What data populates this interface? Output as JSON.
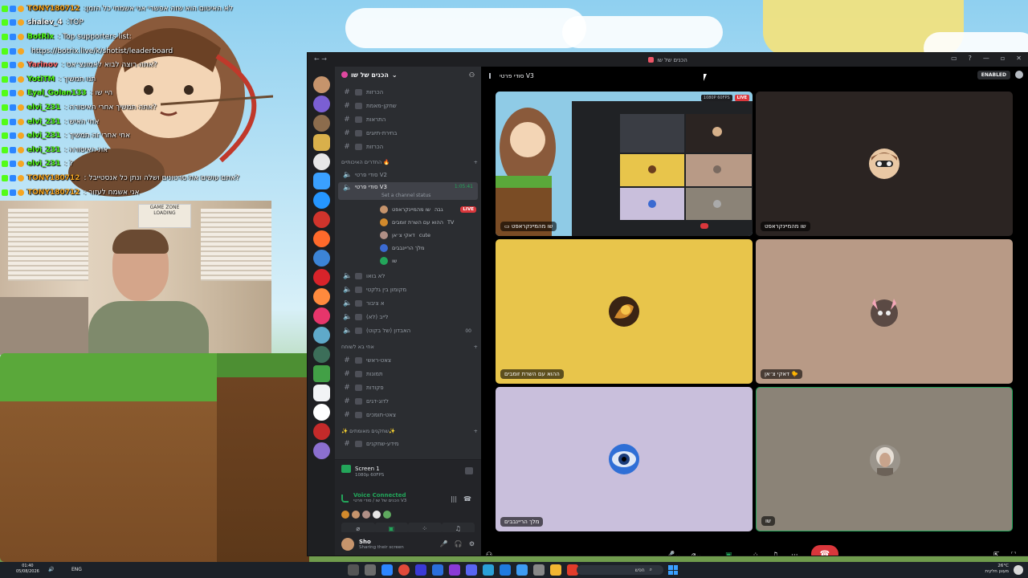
{
  "chat": [
    {
      "name": "TONY180712",
      "color": "#f5a623",
      "msg": ":לא האיטום הוא שזה אפשרי אני אשמחי כל הזמן"
    },
    {
      "name": "shalev_4",
      "color": "#ffffff",
      "msg": ":TOP"
    },
    {
      "name": "BotRix",
      "color": "#53fc18",
      "msg": ": Top supporters list:"
    },
    {
      "name": "",
      "color": "#8a7cff",
      "msg": "https://botrix.live/k/shotist/leaderboard"
    },
    {
      "name": "Yarinov",
      "color": "#ff6b6b",
      "msg": ": אתה רוצה לבוא לאמונצ׳אס?"
    },
    {
      "name": "YotiTM",
      "color": "#53fc18",
      "msg": ": תנו תמשיך"
    },
    {
      "name": "Eyal_Golan133",
      "color": "#53fc18",
      "msg": ": היי שו"
    },
    {
      "name": "elvi_231",
      "color": "#53fc18",
      "msg": ": אתה תמשיך אחרי האיסורה?"
    },
    {
      "name": "elvi_231",
      "color": "#53fc18",
      "msg": ": אחי האיש"
    },
    {
      "name": "elvi_231",
      "color": "#53fc18",
      "msg": ": אחי אחרי זה תמשיך"
    },
    {
      "name": "elvi_231",
      "color": "#53fc18",
      "msg": ": את האיסורה"
    },
    {
      "name": "elvi_231",
      "color": "#53fc18",
      "msg": ": ?"
    },
    {
      "name": "TONY180712",
      "color": "#f5a623",
      "msg": ": אתם עושים את סרטונים ושלה ונתן כל אנסטייבל?"
    },
    {
      "name": "TONY180712",
      "color": "#f5a623",
      "msg": ": אני אשמח לעזור"
    }
  ],
  "webcam": {
    "poster_line1": "GAME ZONE",
    "poster_line2": "LOADING"
  },
  "window": {
    "title": "הכנים של שו"
  },
  "server": {
    "name": "הכנים של שו"
  },
  "channels": [
    {
      "type": "text",
      "label": "הכרזות",
      "y": 0
    },
    {
      "type": "text",
      "label": "שחקן-מאמת",
      "y": 17
    },
    {
      "type": "text",
      "label": "התראות",
      "y": 34
    },
    {
      "type": "text",
      "label": "בחירת-תיוגים",
      "y": 51
    },
    {
      "type": "text",
      "label": "הכרזות",
      "y": 68
    }
  ],
  "category1": {
    "label": "החדרים האיכותיים 🔥"
  },
  "voice_channels_top": [
    {
      "label": "סודי פרטי V2",
      "active": false
    },
    {
      "label": "סודי פרטי V3",
      "active": true,
      "timer": "1:05:41",
      "status": "Set a channel status"
    }
  ],
  "voice_users": [
    {
      "name": "שו מהמיינקראפט",
      "tag": "גבה",
      "live": "LIVE",
      "color": "#c6946c"
    },
    {
      "name": "ההוא עם השרת זומבים",
      "tag": "TV",
      "live": "",
      "color": "#d28a2c"
    },
    {
      "name": "דאקי צ׳אן",
      "tag": "cute",
      "live": "",
      "color": "#b08f86"
    },
    {
      "name": "מלך הריינבבים",
      "tag": "",
      "live": "",
      "color": "#3b6ad1"
    },
    {
      "name": "שו",
      "tag": "",
      "live": "",
      "color": "#23a55a"
    }
  ],
  "voice_channels_mid": [
    {
      "label": "לא בואו"
    },
    {
      "label": "מקומון בין גלקטי"
    },
    {
      "label": "א ציבור"
    },
    {
      "label": "לייב (לא)"
    },
    {
      "label": "האבדון (של בקוט)",
      "count": "00"
    }
  ],
  "category2": {
    "label": "אחי בא לשוחח"
  },
  "text_channels_bottom": [
    {
      "label": "צאט-ראשי"
    },
    {
      "label": "תמונות"
    },
    {
      "label": "פקודות"
    },
    {
      "label": "לדוג-דגים"
    },
    {
      "label": "צאט-תומכים"
    }
  ],
  "category3": {
    "label": "✨ שחקנים מאומתים✨"
  },
  "last_channel": {
    "label": "מידע-שחקנים"
  },
  "screen_panel": {
    "title": "Screen 1",
    "subtitle": "1080p 60FPS"
  },
  "voice_panel": {
    "title": "Voice Connected",
    "subtitle": "הכנים של שו / סודי פרטי V3"
  },
  "user": {
    "name": "Sho",
    "status": "Sharing their screen"
  },
  "stage": {
    "channel": "סודי פרטי V3",
    "enabled": "ENABLED"
  },
  "stream_badges": {
    "quality": "1080P 60FPS",
    "live": "LIVE"
  },
  "tiles": [
    {
      "label": "שו מהמיינקראפט",
      "bg": "#2b2422"
    },
    {
      "label": "שו מהמיינקראפט",
      "bg": "#2b2422"
    },
    {
      "label": "ההוא עם השרת זומבים",
      "bg": "#e8c54b"
    },
    {
      "label": "דאקי צ׳אן 🐤",
      "bg": "#b89a86"
    },
    {
      "label": "מלך הריינבבים",
      "bg": "#c9bfdc"
    },
    {
      "label": "שו",
      "bg": "#8b8377"
    }
  ],
  "taskbar": {
    "time": "01:40",
    "date": "05/08/2026",
    "lang": "ENG",
    "search": "חפש",
    "temp": "26°C",
    "weather": "מעונן חלקית"
  },
  "colors": {
    "accent": "#5865f2",
    "green": "#23a55a",
    "red": "#da373c"
  }
}
